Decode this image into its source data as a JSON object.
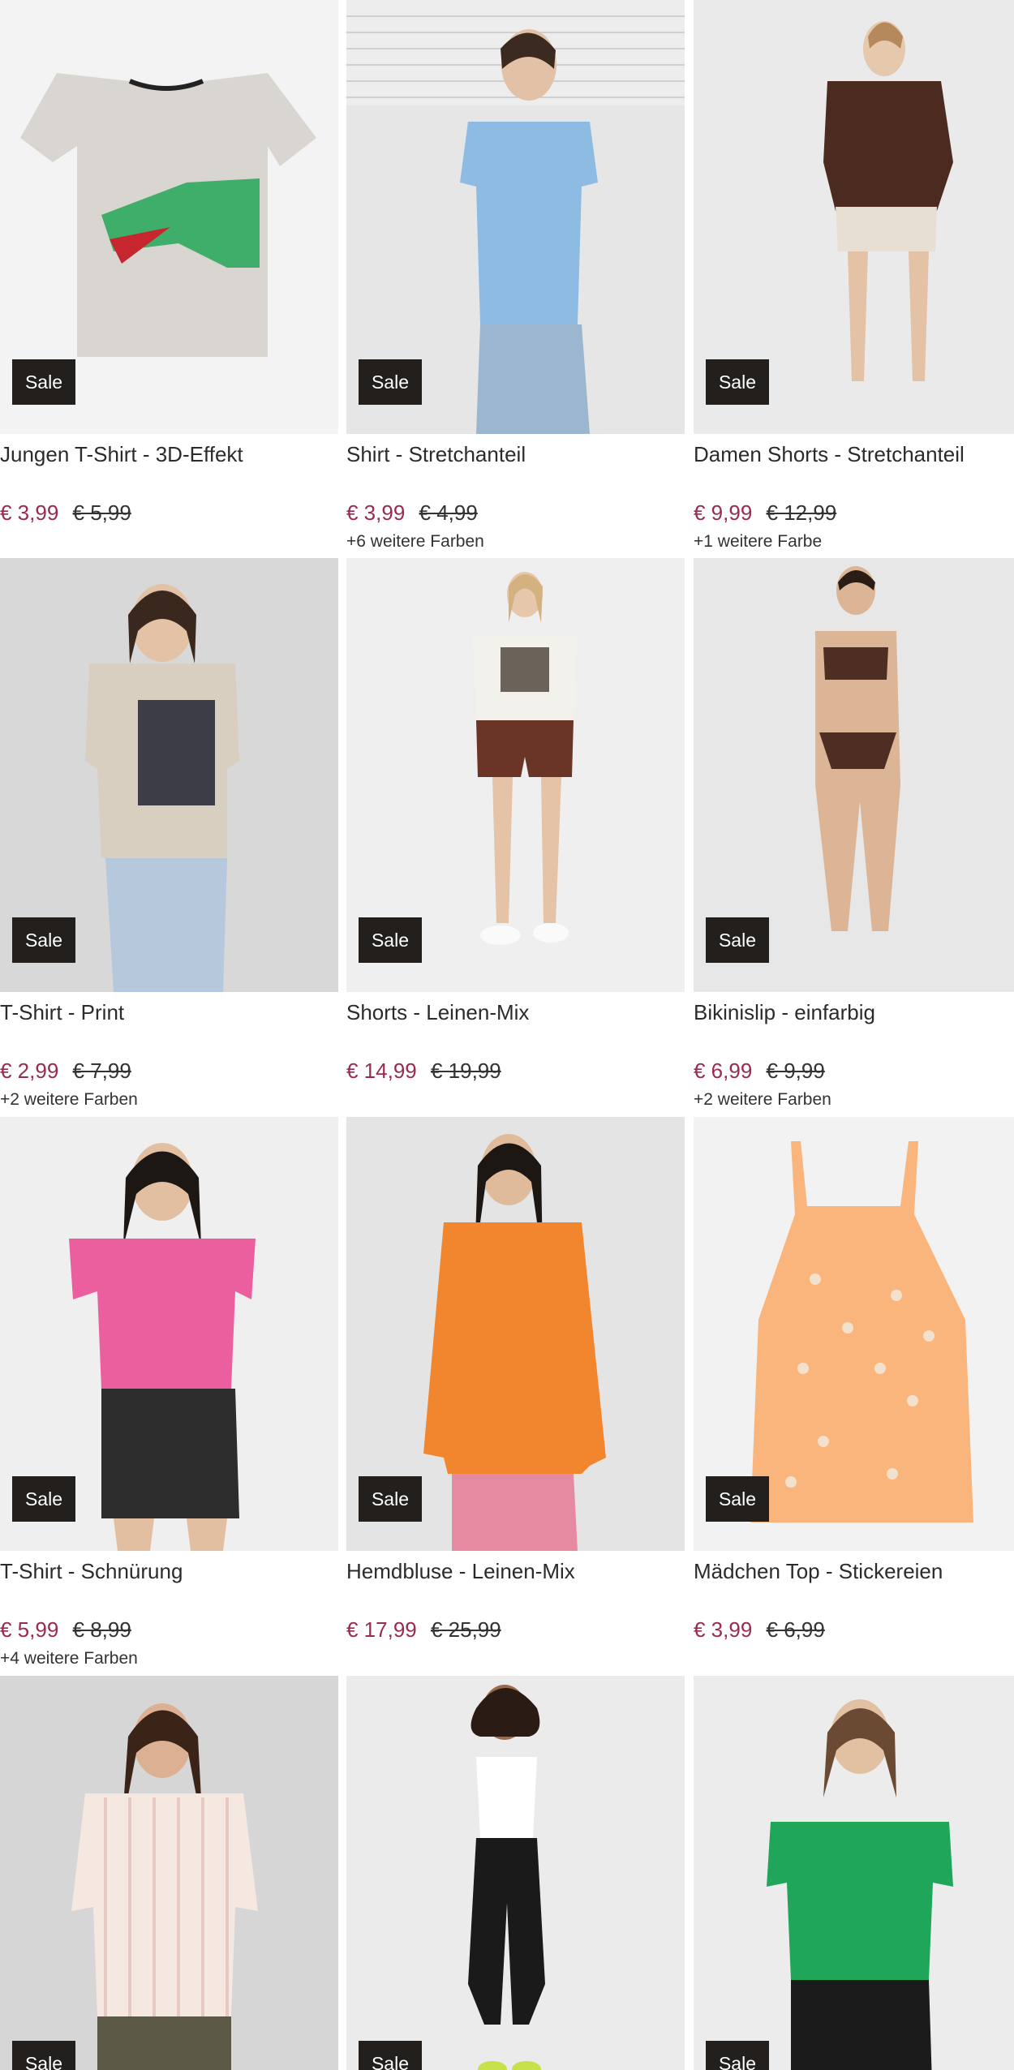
{
  "products": [
    {
      "title": "Jungen T-Shirt - 3D-Effekt",
      "price": "€ 3,99",
      "old_price": "€ 5,99",
      "badge": "Sale",
      "colors": ""
    },
    {
      "title": "Shirt - Stretchanteil",
      "price": "€ 3,99",
      "old_price": "€ 4,99",
      "badge": "Sale",
      "colors": "+6 weitere Farben"
    },
    {
      "title": "Damen Shorts - Stretchanteil",
      "price": "€ 9,99",
      "old_price": "€ 12,99",
      "badge": "Sale",
      "colors": "+1 weitere Farbe"
    },
    {
      "title": "T-Shirt - Print",
      "price": "€ 2,99",
      "old_price": "€ 7,99",
      "badge": "Sale",
      "colors": "+2 weitere Farben"
    },
    {
      "title": "Shorts - Leinen-Mix",
      "price": "€ 14,99",
      "old_price": "€ 19,99",
      "badge": "Sale",
      "colors": ""
    },
    {
      "title": "Bikinislip - einfarbig",
      "price": "€ 6,99",
      "old_price": "€ 9,99",
      "badge": "Sale",
      "colors": "+2 weitere Farben"
    },
    {
      "title": "T-Shirt - Schnürung",
      "price": "€ 5,99",
      "old_price": "€ 8,99",
      "badge": "Sale",
      "colors": "+4 weitere Farben"
    },
    {
      "title": "Hemdbluse - Leinen-Mix",
      "price": "€ 17,99",
      "old_price": "€ 25,99",
      "badge": "Sale",
      "colors": ""
    },
    {
      "title": "Mädchen Top - Stickereien",
      "price": "€ 3,99",
      "old_price": "€ 6,99",
      "badge": "Sale",
      "colors": ""
    },
    {
      "title": "",
      "price": "",
      "old_price": "",
      "badge": "Sale",
      "colors": ""
    },
    {
      "title": "",
      "price": "",
      "old_price": "",
      "badge": "Sale",
      "colors": ""
    },
    {
      "title": "",
      "price": "",
      "old_price": "",
      "badge": "Sale",
      "colors": ""
    }
  ],
  "colors": {
    "price_sale": "#9a2a52",
    "badge_bg": "#221f1d",
    "badge_text": "#ffffff"
  }
}
